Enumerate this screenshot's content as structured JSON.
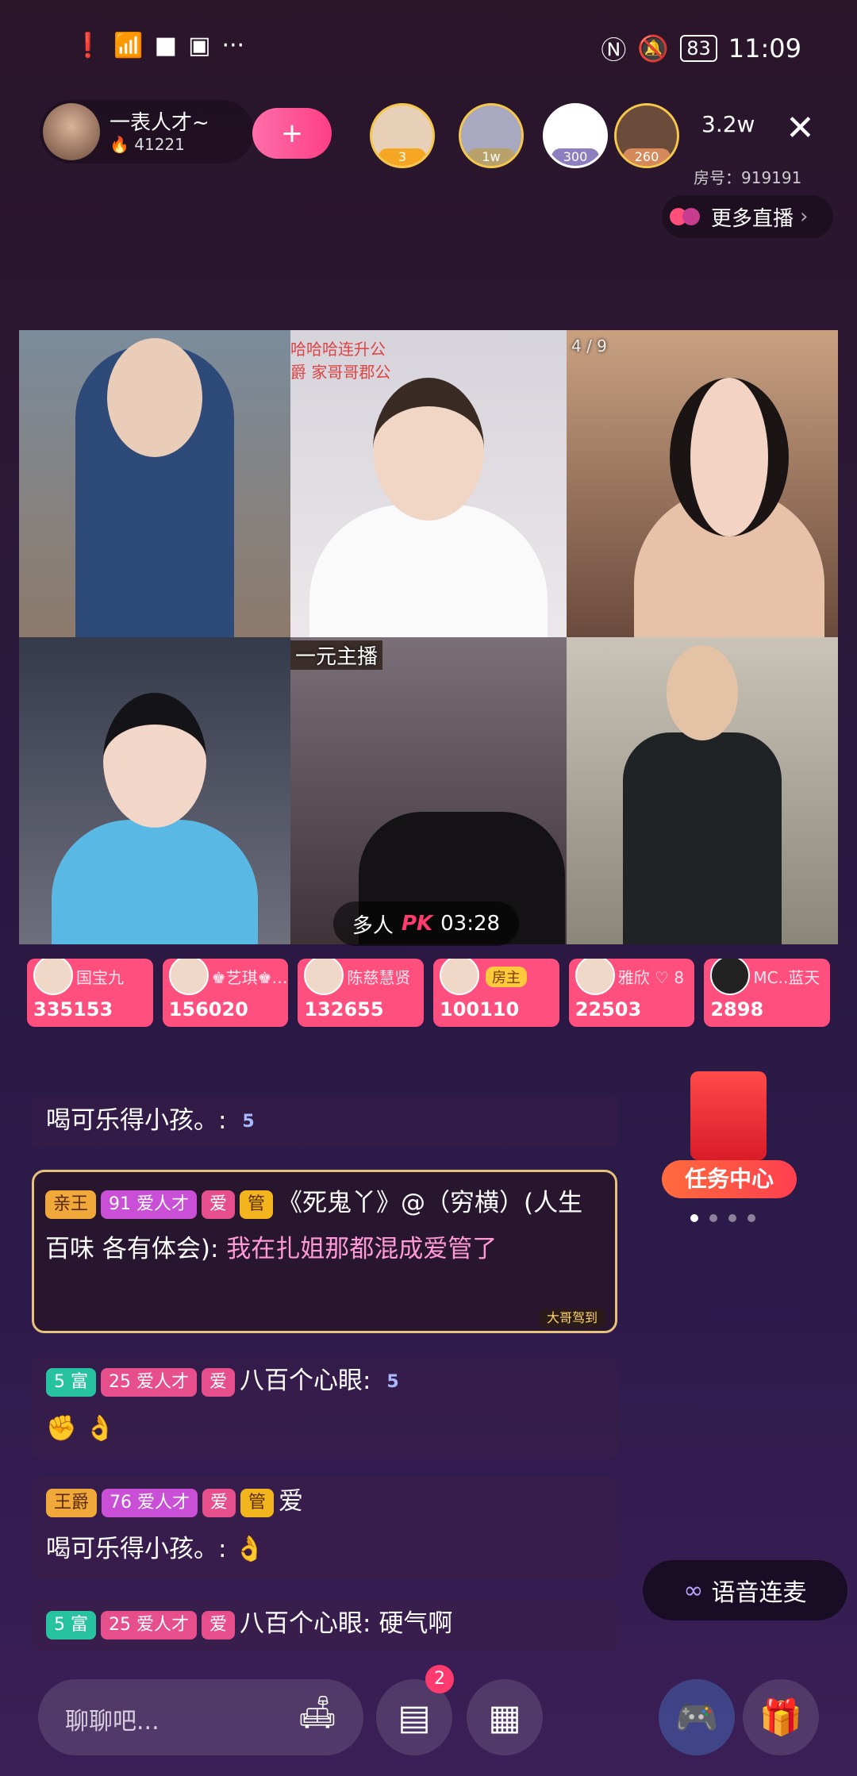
{
  "status_bar": {
    "time": "11:09",
    "battery": "83",
    "left_icons": [
      "alert-icon",
      "wifi-icon",
      "camera-icon",
      "app-icon"
    ],
    "more": "···"
  },
  "host": {
    "name": "一表人才~",
    "heat": "🔥 41221",
    "follow_symbol": "+"
  },
  "viewers": [
    {
      "badge": "3",
      "color": "#f5a623"
    },
    {
      "badge": "1w",
      "color": "#b8a16a"
    },
    {
      "badge": "300",
      "color": "#8d7fbf"
    },
    {
      "badge": "260",
      "color": "#d6895b"
    }
  ],
  "viewer_count": "3.2w",
  "close_symbol": "✕",
  "room_number": "房号：919191",
  "more_live": "更多直播",
  "more_chevron": "›",
  "video": {
    "cell2_overlay": "哈哈哈连升公爵 家哥哥郡公",
    "cell3_overlay": "4 / 9",
    "cell5_label": "一元主播",
    "pk_label": "多人",
    "pk_mark": "PK",
    "pk_timer": "03:28"
  },
  "tiles": [
    {
      "name": "国宝九",
      "score": "335153"
    },
    {
      "name": "♚艺琪♚…",
      "score": "156020"
    },
    {
      "name": "陈慈慧贤",
      "score": "132655"
    },
    {
      "name": "",
      "owner": "房主",
      "score": "100110"
    },
    {
      "name": "雅欣 ♡ 8",
      "score": "22503"
    },
    {
      "name": "MC..蓝天",
      "score": "2898"
    }
  ],
  "chat": {
    "m1_user": "喝可乐得小孩。:",
    "m1_level": "5",
    "fancy_badge1": "亲王",
    "fancy_badge2": "91 爱人才",
    "fancy_badge_love": "爱",
    "fancy_badge_guan": "管",
    "fancy_user": "《死鬼丫》@（穷横）(人生百味 各有体会):",
    "fancy_text": "我在扎姐那都混成爱管了",
    "fancy_corner": "大哥驾到",
    "m2_rank": "5 富",
    "m2_fan": "25 爱人才",
    "m2_love": "爱",
    "m2_user": "八百个心眼:",
    "m2_level": "5",
    "m2_emoji": "✊ 👌",
    "m3_rank": "王爵",
    "m3_fan": "76 爱人才",
    "m3_love": "爱",
    "m3_guan": "管",
    "m3_tail": "爱",
    "m3_line2": "喝可乐得小孩。: 👌",
    "m4_rank": "5 富",
    "m4_fan": "25 爱人才",
    "m4_love": "爱",
    "m4_user": "八百个心眼:",
    "m4_text": "硬气啊"
  },
  "task_center": "任务中心",
  "voice_link": "语音连麦",
  "input_placeholder": "聊聊吧...",
  "notif_count": "2",
  "colors": {
    "accent": "#ff4f7e",
    "gold_frame": "#e8c27a"
  }
}
